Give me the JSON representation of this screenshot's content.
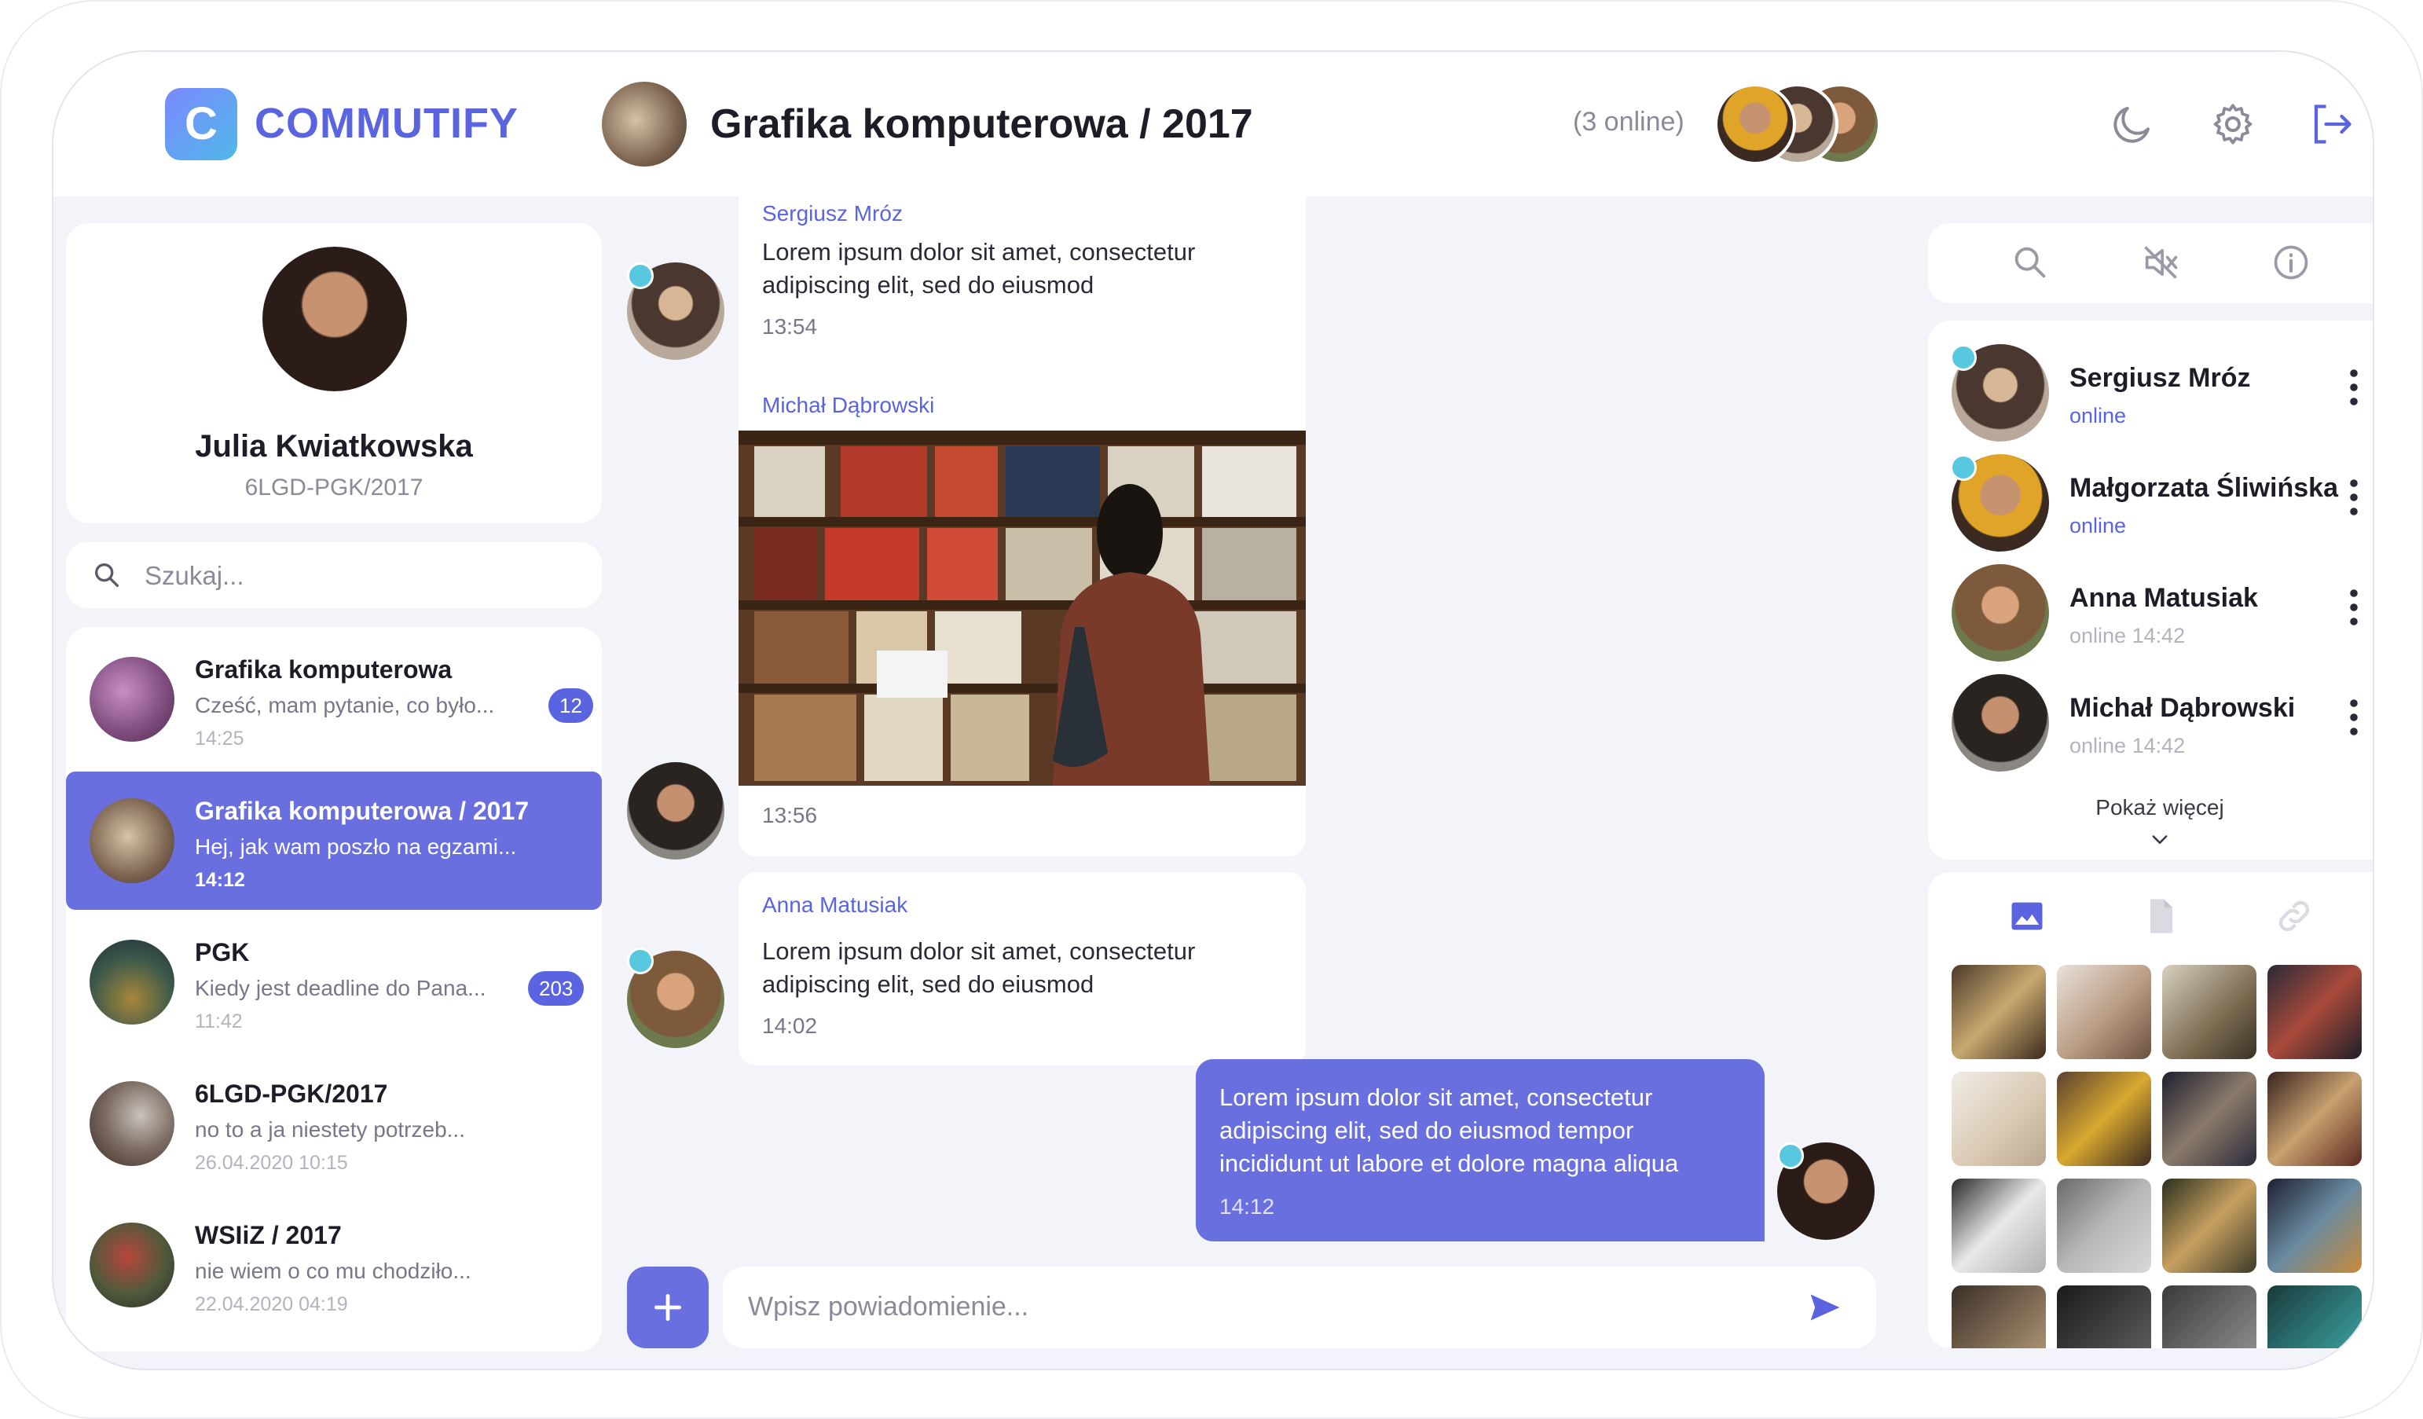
{
  "app": {
    "logo_letter": "C",
    "logo_text": "COMMUTIFY"
  },
  "header": {
    "room_title": "Grafika komputerowa / 2017",
    "online_count": "(3 online)",
    "icons": [
      "moon-icon",
      "gear-icon",
      "logout-icon"
    ]
  },
  "profile": {
    "name": "Julia Kwiatkowska",
    "code": "6LGD-PGK/2017"
  },
  "search": {
    "placeholder": "Szukaj..."
  },
  "conversations": [
    {
      "name": "Grafika komputerowa",
      "message": "Cześć, mam pytanie, co było...",
      "time": "14:25",
      "badge": "12",
      "active": false
    },
    {
      "name": "Grafika komputerowa / 2017",
      "message": "Hej, jak wam poszło na egzami...",
      "time": "14:12",
      "badge": "",
      "active": true
    },
    {
      "name": "PGK",
      "message": "Kiedy jest deadline do Pana...",
      "time": "11:42",
      "badge": "203",
      "active": false
    },
    {
      "name": "6LGD-PGK/2017",
      "message": "no to a ja niestety potrzeb...",
      "time": "26.04.2020 10:15",
      "badge": "",
      "active": false
    },
    {
      "name": "WSIiZ / 2017",
      "message": "nie wiem o co mu chodziło...",
      "time": "22.04.2020 04:19",
      "badge": "",
      "active": false
    }
  ],
  "messages": [
    {
      "sender": "Sergiusz Mróz",
      "line1": "Lorem ipsum dolor sit amet, consectetur",
      "line2": "adipiscing elit, sed do eiusmod",
      "time": "13:54"
    },
    {
      "sender": "Michał Dąbrowski",
      "time": "13:56"
    },
    {
      "sender": "Anna Matusiak",
      "line1": "Lorem ipsum dolor sit amet, consectetur",
      "line2": "adipiscing elit, sed do eiusmod",
      "time": "14:02"
    },
    {
      "sender": "",
      "line1": "Lorem ipsum dolor sit amet, consectetur",
      "line2": "adipiscing elit, sed do eiusmod tempor",
      "line3": "incididunt ut labore et dolore magna aliqua",
      "time": "14:12"
    }
  ],
  "composer": {
    "placeholder": "Wpisz powiadomienie..."
  },
  "members": [
    {
      "name": "Sergiusz Mróz",
      "status": "online"
    },
    {
      "name": "Małgorzata Śliwińska",
      "status": "online"
    },
    {
      "name": "Anna Matusiak",
      "status": "online 14:42"
    },
    {
      "name": "Michał Dąbrowski",
      "status": "online 14:42"
    }
  ],
  "show_more": "Pokaż więcej",
  "colors": {
    "accent": "#6a6fdf",
    "brand": "#5a63e0",
    "online": "#58c8e0",
    "background": "#f3f4f9"
  }
}
